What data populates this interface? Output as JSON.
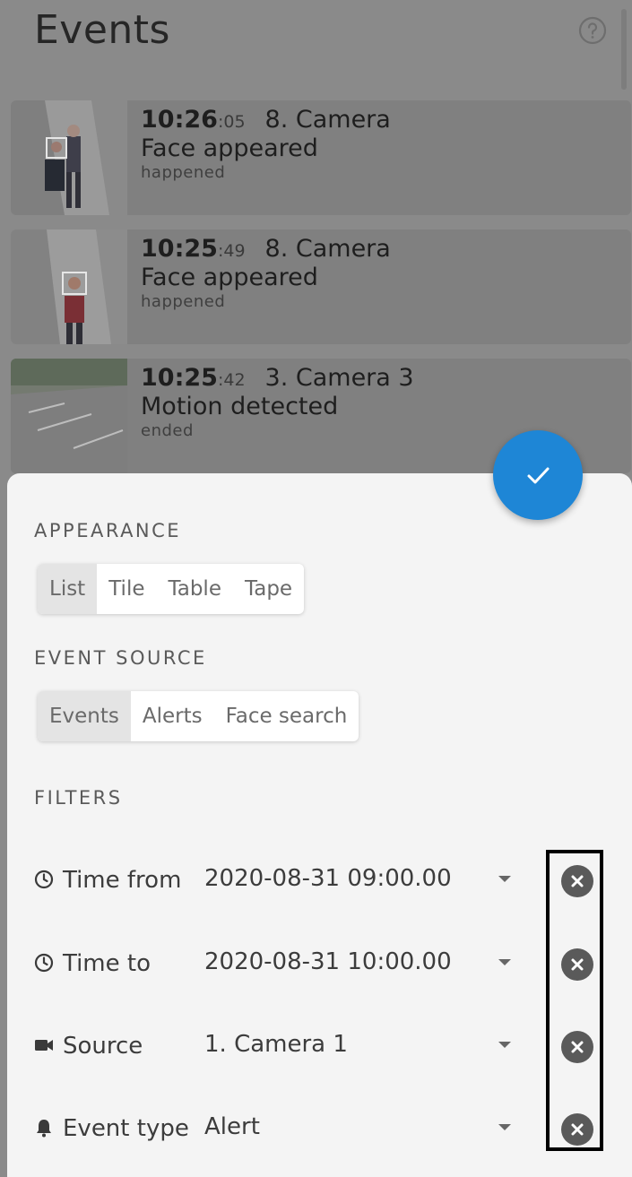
{
  "header": {
    "title": "Events",
    "help_icon": "help-circle-icon"
  },
  "events": [
    {
      "time_main": "10:26",
      "time_sec": ":05",
      "camera": "8. Camera",
      "type": "Face appeared",
      "status": "happened"
    },
    {
      "time_main": "10:25",
      "time_sec": ":49",
      "camera": "8. Camera",
      "type": "Face appeared",
      "status": "happened"
    },
    {
      "time_main": "10:25",
      "time_sec": ":42",
      "camera": "3. Camera 3",
      "type": "Motion detected",
      "status": "ended"
    }
  ],
  "sheet": {
    "apply_icon": "checkmark-icon",
    "appearance": {
      "label": "APPEARANCE",
      "options": [
        "List",
        "Tile",
        "Table",
        "Tape"
      ],
      "selected": "List"
    },
    "event_source": {
      "label": "EVENT SOURCE",
      "options": [
        "Events",
        "Alerts",
        "Face search"
      ],
      "selected": "Events"
    },
    "filters": {
      "label": "FILTERS",
      "rows": [
        {
          "icon": "clock-icon",
          "label": "Time from",
          "value": "2020-08-31 09:00.00"
        },
        {
          "icon": "clock-icon",
          "label": "Time to",
          "value": "2020-08-31 10:00.00"
        },
        {
          "icon": "video-camera-icon",
          "label": "Source",
          "value": "1. Camera 1"
        },
        {
          "icon": "bell-icon",
          "label": "Event type",
          "value": "Alert"
        }
      ]
    }
  },
  "colors": {
    "accent": "#1e86d6",
    "clear_button": "#5a5a5a",
    "sheet_bg": "#f4f4f4"
  }
}
